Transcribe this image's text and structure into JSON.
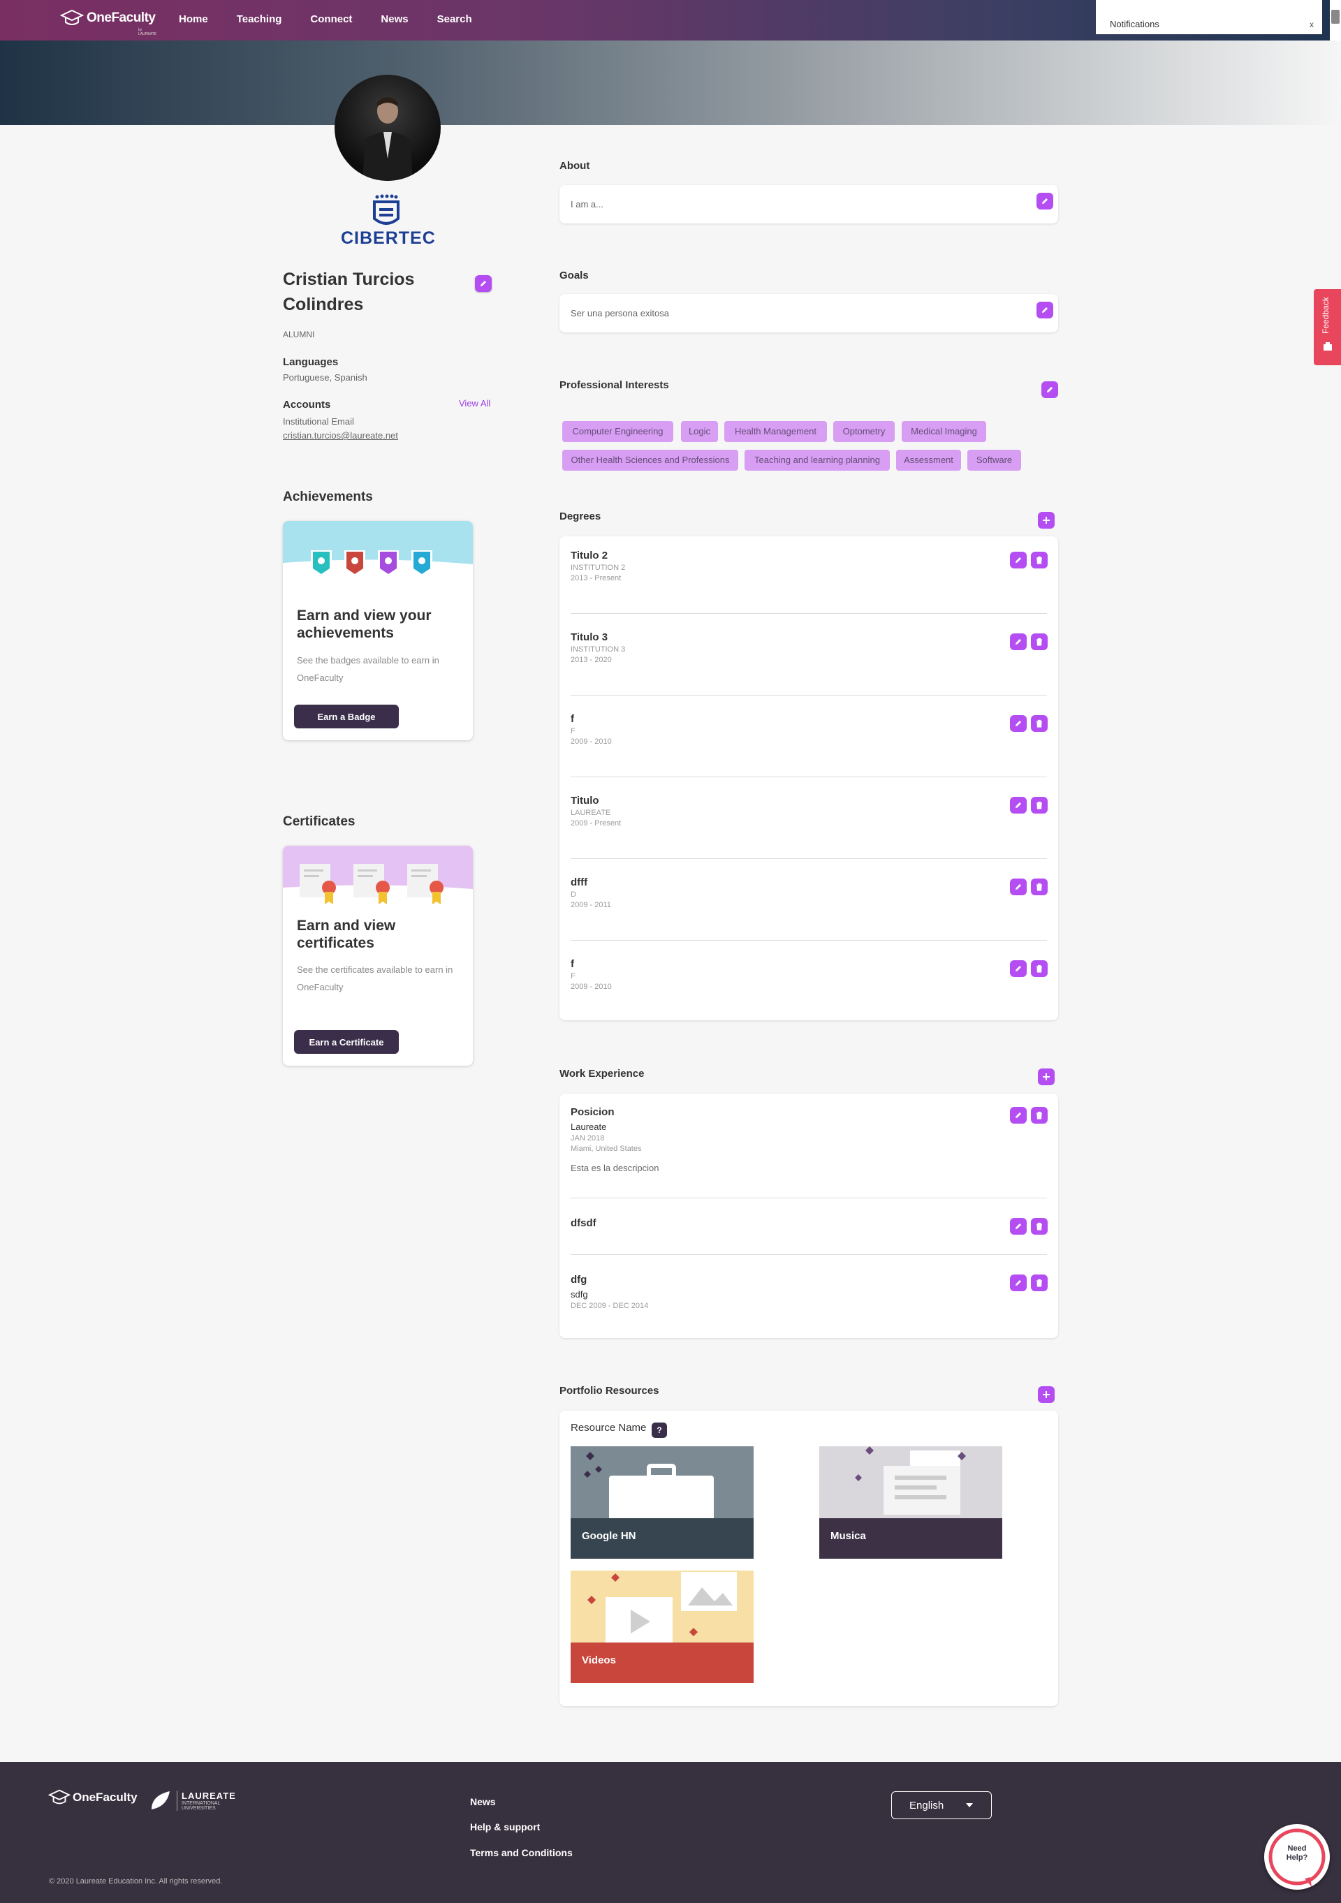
{
  "nav": {
    "brand": "OneFaculty",
    "brand_sub": "by LAUREATE",
    "links": [
      "Home",
      "Teaching",
      "Connect",
      "News",
      "Search"
    ],
    "notifications_label": "Notifications",
    "notifications_close": "x"
  },
  "profile": {
    "school_logo_text": "CIBERTEC",
    "name": "Cristian Turcios Colindres",
    "role": "ALUMNI",
    "languages_label": "Languages",
    "languages": "Portuguese, Spanish",
    "accounts_label": "Accounts",
    "view_all": "View All",
    "institutional_email_label": "Institutional Email",
    "email": "cristian.turcios@laureate.net"
  },
  "achievements": {
    "heading": "Achievements",
    "card_title": "Earn and view your achievements",
    "card_text": "See the badges available to earn in OneFaculty",
    "button": "Earn a Badge"
  },
  "certificates": {
    "heading": "Certificates",
    "card_title": "Earn and view certificates",
    "card_text": "See the certificates available to earn in OneFaculty",
    "button": "Earn a Certificate"
  },
  "about": {
    "heading": "About",
    "placeholder": "I am a..."
  },
  "goals": {
    "heading": "Goals",
    "text": "Ser una persona exitosa"
  },
  "interests": {
    "heading": "Professional Interests",
    "tags": [
      "Computer Engineering",
      "Logic",
      "Health Management",
      "Optometry",
      "Medical Imaging",
      "Other Health Sciences and Professions",
      "Teaching and learning planning",
      "Assessment",
      "Software"
    ]
  },
  "degrees": {
    "heading": "Degrees",
    "items": [
      {
        "title": "Titulo 2",
        "institution": "INSTITUTION 2",
        "dates": "2013 - Present"
      },
      {
        "title": "Titulo 3",
        "institution": "INSTITUTION 3",
        "dates": "2013 - 2020"
      },
      {
        "title": "f",
        "institution": "F",
        "dates": "2009 - 2010"
      },
      {
        "title": "Titulo",
        "institution": "LAUREATE",
        "dates": "2009 - Present"
      },
      {
        "title": "dfff",
        "institution": "D",
        "dates": "2009 - 2011"
      },
      {
        "title": "f",
        "institution": "F",
        "dates": "2009 - 2010"
      }
    ]
  },
  "work": {
    "heading": "Work Experience",
    "items": [
      {
        "title": "Posicion",
        "company": "Laureate",
        "dates": "JAN 2018",
        "location": "Miami, United States",
        "description": "Esta es la descripcion"
      },
      {
        "title": "dfsdf"
      },
      {
        "title": "dfg",
        "company": "sdfg",
        "dates": "DEC 2009 - DEC 2014"
      }
    ]
  },
  "portfolio": {
    "heading": "Portfolio Resources",
    "column_label": "Resource Name",
    "help_glyph": "?",
    "items": [
      {
        "name": "Google HN",
        "color": "#36454f"
      },
      {
        "name": "Musica",
        "color": "#3d3146"
      },
      {
        "name": "Videos",
        "color": "#c8463b"
      }
    ]
  },
  "feedback": "Feedback",
  "footer": {
    "brand": "OneFaculty",
    "laureate": "LAUREATE",
    "laureate_sub": "INTERNATIONAL UNIVERSITIES",
    "links": [
      "News",
      "Help & support",
      "Terms and Conditions"
    ],
    "language": "English",
    "copyright": "© 2020 Laureate Education Inc. All rights reserved.",
    "need_help": "Need Help?"
  },
  "colors": {
    "accent": "#b44ef3",
    "tag_bg": "#d79ef3",
    "footer_bg": "#37303f",
    "feedback": "#e8465c"
  }
}
